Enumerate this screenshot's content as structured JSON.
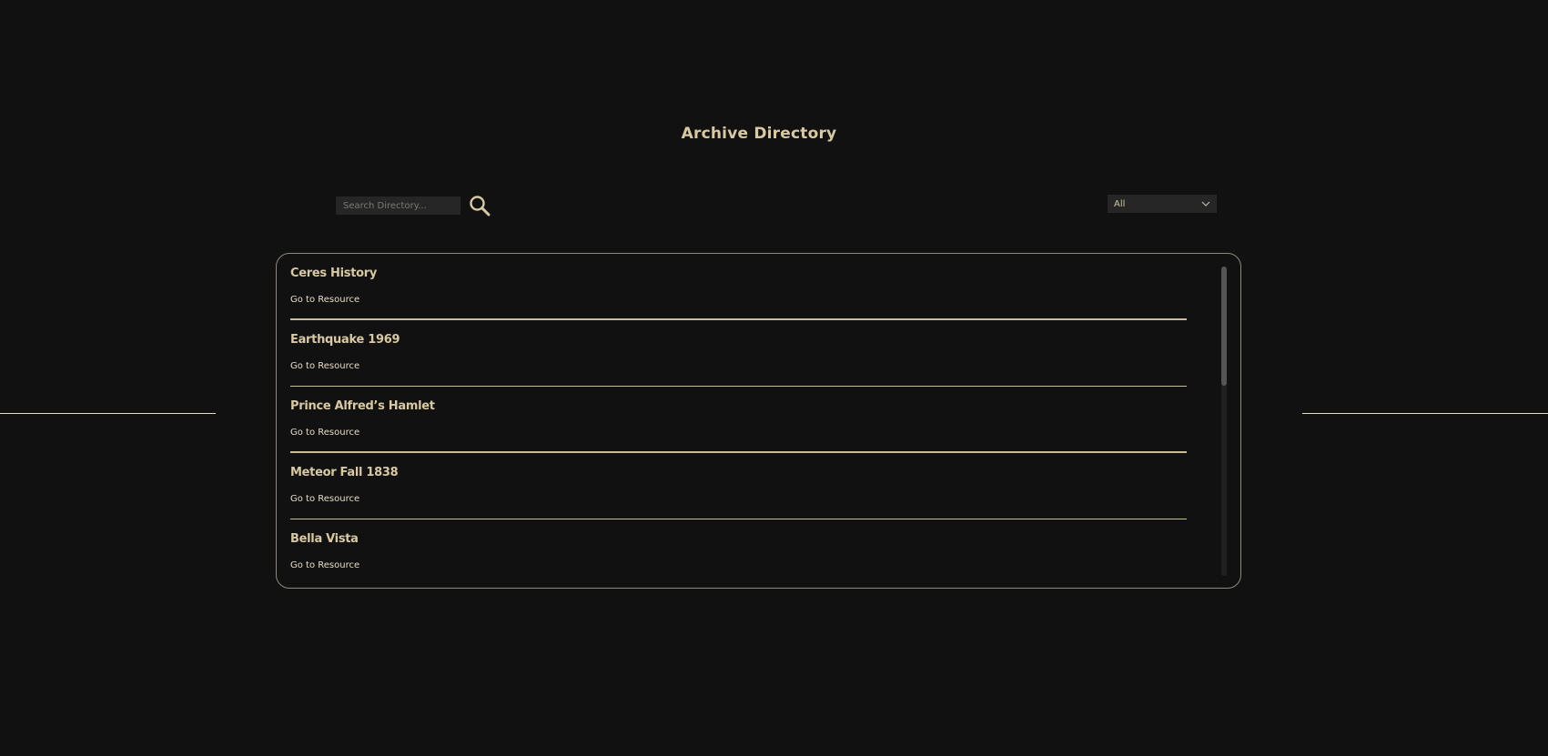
{
  "header": {
    "title": "Archive Directory"
  },
  "search": {
    "placeholder": "Search Directory...",
    "value": "",
    "icon": "search-icon"
  },
  "filter": {
    "selected": "All",
    "icon": "chevron-down-icon"
  },
  "directory": {
    "entries": [
      {
        "title": "Ceres History",
        "link_label": "Go to Resource"
      },
      {
        "title": "Earthquake 1969",
        "link_label": "Go to Resource"
      },
      {
        "title": "Prince Alfred’s Hamlet",
        "link_label": "Go to Resource"
      },
      {
        "title": "Meteor Fall 1838",
        "link_label": "Go to Resource"
      },
      {
        "title": "Bella Vista",
        "link_label": "Go to Resource"
      }
    ]
  },
  "colors": {
    "background": "#111111",
    "accent": "#d8c9a2",
    "panel_border": "#8f8a78",
    "input_bg": "#262626"
  }
}
